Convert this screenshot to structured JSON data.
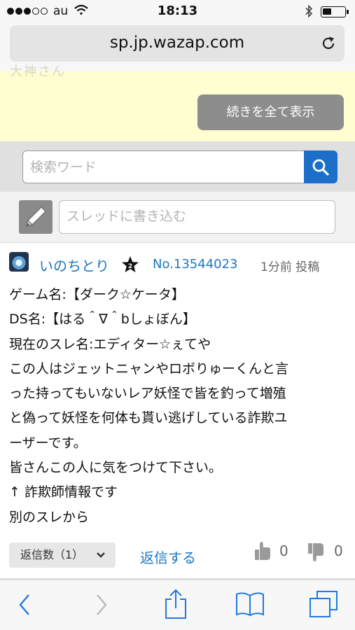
{
  "status_bar": {
    "carrier": "au",
    "time": "18:13",
    "signal_bars_filled": 3,
    "signal_bars_total": 5,
    "icons": [
      "wifi-icon",
      "bluetooth-icon",
      "battery-icon"
    ]
  },
  "browser": {
    "url": "sp.jp.wazap.com",
    "reload_icon": "reload-icon"
  },
  "ad_area": {
    "faded_text": "大神さん",
    "show_all_button": "続きを全て表示",
    "background": "#fefed0"
  },
  "search": {
    "placeholder": "検索ワード",
    "icon": "search-icon",
    "button_color": "#1b6fc8"
  },
  "write": {
    "icon": "pencil-icon",
    "placeholder": "スレッドに書き込む"
  },
  "post": {
    "username": "いのちとり",
    "rank_badge": "2",
    "post_number": "No.13544023",
    "time": "1分前 投稿",
    "lines": [
      "ゲーム名:【ダーク☆ケータ】",
      "DS名:【はる＾∇＾bしょぼん】",
      "現在のスレ名:エディター☆ぇてや",
      "この人はジェットニャンやロボりゅーくんと言",
      "った持ってもいないレア妖怪で皆を釣って増殖",
      "と偽って妖怪を何体も貰い逃げしている詐欺ユ",
      "ーザーです。",
      "皆さんこの人に気をつけて下さい。",
      "↑ 詐欺師情報です",
      "別のスレから"
    ],
    "reply_count_label": "返信数（1）",
    "reply_link": "返信する",
    "like_count": "0",
    "dislike_count": "0",
    "link_color": "#1c78c4"
  },
  "toolbar": {
    "icons": [
      "back-icon",
      "forward-icon",
      "share-icon",
      "bookmarks-icon",
      "tabs-icon"
    ],
    "accent": "#1f7ae0"
  }
}
